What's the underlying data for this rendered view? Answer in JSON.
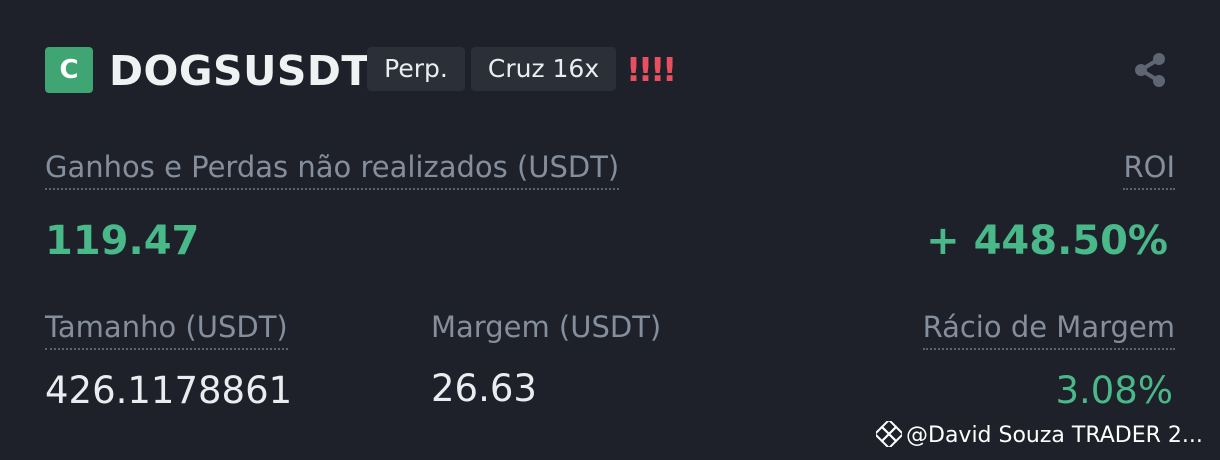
{
  "header": {
    "badge": "C",
    "symbol": "DOGSUSDT",
    "contract_type": "Perp.",
    "margin_mode": "Cruz 16x",
    "risk_marks": "!!!!",
    "share_icon": "share-icon"
  },
  "pnl": {
    "label": "Ganhos e Perdas não realizados (USDT)",
    "value": "119.47"
  },
  "roi": {
    "label": "ROI",
    "value": "+ 448.50%"
  },
  "size": {
    "label": "Tamanho (USDT)",
    "value": "426.1178861"
  },
  "margin": {
    "label": "Margem (USDT)",
    "value": "26.63"
  },
  "margin_ratio": {
    "label": "Rácio de Margem",
    "value": "3.08%"
  },
  "watermark": {
    "text": "@David Souza TRADER 2...",
    "icon": "binance-square-icon"
  },
  "colors": {
    "background": "#1e2129",
    "positive": "#49b98a",
    "badge": "#3fa673",
    "risk": "#e8505f",
    "muted": "#848e9c"
  }
}
